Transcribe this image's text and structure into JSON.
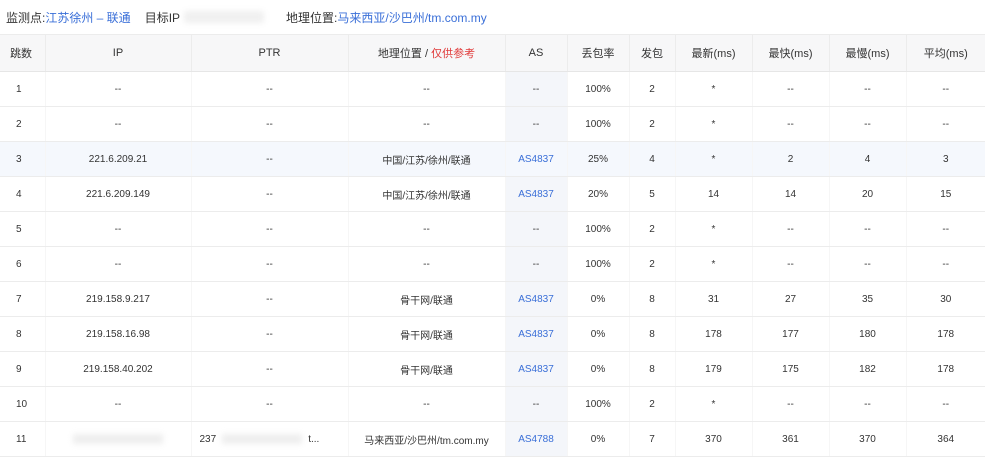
{
  "header": {
    "monitor_label": "监测点:",
    "monitor_value": "江苏徐州 – 联通",
    "target_label": "目标IP",
    "geo_label": "地理位置:",
    "geo_value": "马来西亚/沙巴州/tm.com.my"
  },
  "columns": {
    "hop": "跳数",
    "ip": "IP",
    "ptr": "PTR",
    "geo": "地理位置",
    "geo_sep": " / ",
    "geo_note": "仅供参考",
    "as": "AS",
    "loss": "丢包率",
    "sent": "发包",
    "last": "最新(ms)",
    "best": "最快(ms)",
    "worst": "最慢(ms)",
    "avg": "平均(ms)"
  },
  "rows": [
    {
      "hop": "1",
      "ip": "--",
      "ptr": "--",
      "geo": "--",
      "as": "--",
      "loss": "100%",
      "sent": "2",
      "last": "*",
      "best": "--",
      "worst": "--",
      "avg": "--"
    },
    {
      "hop": "2",
      "ip": "--",
      "ptr": "--",
      "geo": "--",
      "as": "--",
      "loss": "100%",
      "sent": "2",
      "last": "*",
      "best": "--",
      "worst": "--",
      "avg": "--"
    },
    {
      "hop": "3",
      "ip": "221.6.209.21",
      "ptr": "--",
      "geo": "中国/江苏/徐州/联通",
      "as": "AS4837",
      "loss": "25%",
      "sent": "4",
      "last": "*",
      "best": "2",
      "worst": "4",
      "avg": "3"
    },
    {
      "hop": "4",
      "ip": "221.6.209.149",
      "ptr": "--",
      "geo": "中国/江苏/徐州/联通",
      "as": "AS4837",
      "loss": "20%",
      "sent": "5",
      "last": "14",
      "best": "14",
      "worst": "20",
      "avg": "15"
    },
    {
      "hop": "5",
      "ip": "--",
      "ptr": "--",
      "geo": "--",
      "as": "--",
      "loss": "100%",
      "sent": "2",
      "last": "*",
      "best": "--",
      "worst": "--",
      "avg": "--"
    },
    {
      "hop": "6",
      "ip": "--",
      "ptr": "--",
      "geo": "--",
      "as": "--",
      "loss": "100%",
      "sent": "2",
      "last": "*",
      "best": "--",
      "worst": "--",
      "avg": "--"
    },
    {
      "hop": "7",
      "ip": "219.158.9.217",
      "ptr": "--",
      "geo": "骨干网/联通",
      "as": "AS4837",
      "loss": "0%",
      "sent": "8",
      "last": "31",
      "best": "27",
      "worst": "35",
      "avg": "30"
    },
    {
      "hop": "8",
      "ip": "219.158.16.98",
      "ptr": "--",
      "geo": "骨干网/联通",
      "as": "AS4837",
      "loss": "0%",
      "sent": "8",
      "last": "178",
      "best": "177",
      "worst": "180",
      "avg": "178"
    },
    {
      "hop": "9",
      "ip": "219.158.40.202",
      "ptr": "--",
      "geo": "骨干网/联通",
      "as": "AS4837",
      "loss": "0%",
      "sent": "8",
      "last": "179",
      "best": "175",
      "worst": "182",
      "avg": "178"
    },
    {
      "hop": "10",
      "ip": "--",
      "ptr": "--",
      "geo": "--",
      "as": "--",
      "loss": "100%",
      "sent": "2",
      "last": "*",
      "best": "--",
      "worst": "--",
      "avg": "--"
    },
    {
      "hop": "11",
      "ip": "",
      "ptr": "237",
      "ptr_tail": "t...",
      "geo": "马来西亚/沙巴州/tm.com.my",
      "as": "AS4788",
      "loss": "0%",
      "sent": "7",
      "last": "370",
      "best": "361",
      "worst": "370",
      "avg": "364"
    }
  ],
  "colors": {
    "accent": "#3a6fd8",
    "note": "#e03a3a",
    "header_bg": "#f7f7f8",
    "highlight_row": "#f5f8fd"
  }
}
